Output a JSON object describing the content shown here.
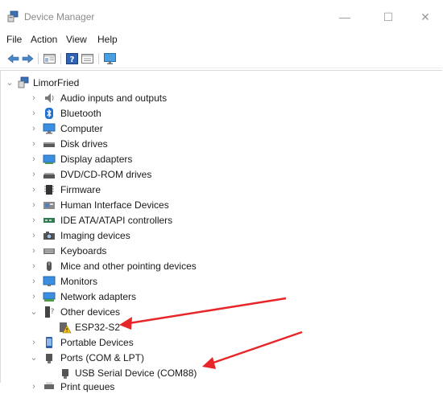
{
  "window": {
    "title": "Device Manager",
    "controls": {
      "minimize": "—",
      "maximize": "☐",
      "close": "✕"
    }
  },
  "menubar": {
    "items": [
      "File",
      "Action",
      "View",
      "Help"
    ]
  },
  "toolbar": {
    "buttons": [
      "back-icon",
      "forward-icon",
      "show-hide-tree-icon",
      "help-icon",
      "properties-icon",
      "monitor-icon"
    ]
  },
  "tree": {
    "root": "LimorFried",
    "items": [
      {
        "label": "Audio inputs and outputs",
        "icon": "speaker-icon",
        "expanded": false
      },
      {
        "label": "Bluetooth",
        "icon": "bluetooth-icon",
        "expanded": false
      },
      {
        "label": "Computer",
        "icon": "computer-icon",
        "expanded": false
      },
      {
        "label": "Disk drives",
        "icon": "disk-drive-icon",
        "expanded": false
      },
      {
        "label": "Display adapters",
        "icon": "display-adapter-icon",
        "expanded": false
      },
      {
        "label": "DVD/CD-ROM drives",
        "icon": "dvd-drive-icon",
        "expanded": false
      },
      {
        "label": "Firmware",
        "icon": "firmware-icon",
        "expanded": false
      },
      {
        "label": "Human Interface Devices",
        "icon": "hid-icon",
        "expanded": false
      },
      {
        "label": "IDE ATA/ATAPI controllers",
        "icon": "ide-controller-icon",
        "expanded": false
      },
      {
        "label": "Imaging devices",
        "icon": "camera-icon",
        "expanded": false
      },
      {
        "label": "Keyboards",
        "icon": "keyboard-icon",
        "expanded": false
      },
      {
        "label": "Mice and other pointing devices",
        "icon": "mouse-icon",
        "expanded": false
      },
      {
        "label": "Monitors",
        "icon": "monitor-icon",
        "expanded": false
      },
      {
        "label": "Network adapters",
        "icon": "network-adapter-icon",
        "expanded": false
      },
      {
        "label": "Other devices",
        "icon": "other-devices-icon",
        "expanded": true
      },
      {
        "label": "ESP32-S2",
        "icon": "warning-device-icon",
        "child": true
      },
      {
        "label": "Portable Devices",
        "icon": "portable-device-icon",
        "expanded": false
      },
      {
        "label": "Ports (COM & LPT)",
        "icon": "port-icon",
        "expanded": true
      },
      {
        "label": "USB Serial Device (COM88)",
        "icon": "usb-serial-icon",
        "child": true
      },
      {
        "label": "Print queues",
        "icon": "printer-icon",
        "expanded": false
      }
    ]
  },
  "annotation": {
    "arrow_color": "#e8262a"
  }
}
